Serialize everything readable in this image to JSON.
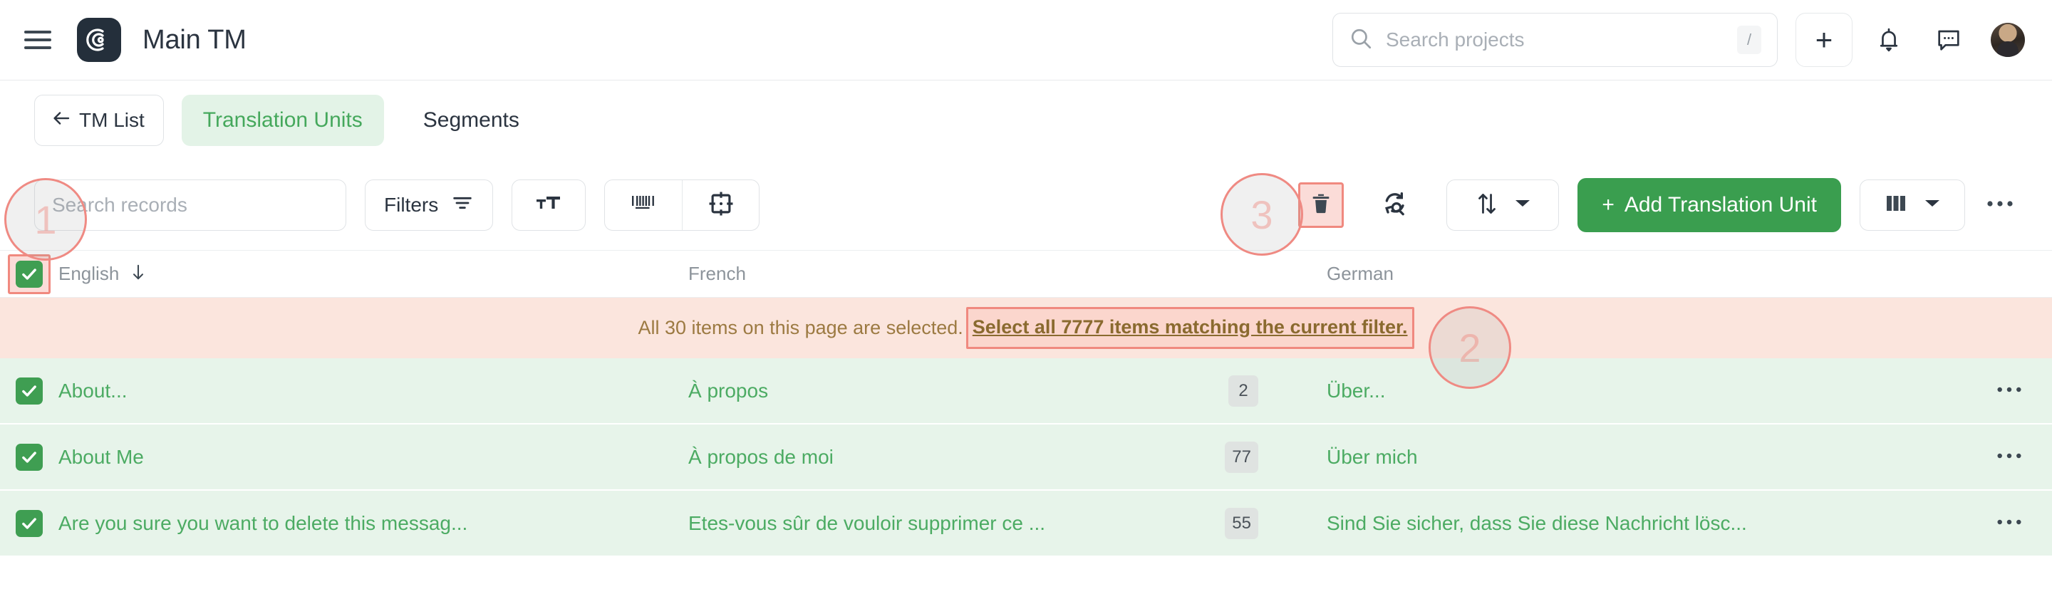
{
  "header": {
    "menu_icon": "hamburger-icon",
    "logo_icon": "app-logo-icon",
    "title": "Main TM",
    "search": {
      "placeholder": "Search projects",
      "shortcut": "/",
      "icon": "search-icon"
    },
    "add_button_label": "+",
    "notifications_icon": "bell-icon",
    "messages_icon": "chat-icon",
    "avatar": "user-avatar"
  },
  "tabs": {
    "back_label": "TM List",
    "back_icon": "arrow-left-icon",
    "items": [
      {
        "label": "Translation Units",
        "active": true
      },
      {
        "label": "Segments",
        "active": false
      }
    ]
  },
  "toolbar": {
    "search_placeholder": "Search records",
    "filters_label": "Filters",
    "filters_icon": "filter-icon",
    "font_size_icon": "text-size-icon",
    "barcode_icon": "barcode-icon",
    "tag_icon": "placeholder-target-icon",
    "delete_icon": "trash-icon",
    "refresh_icon": "refresh-search-icon",
    "sort_icon": "sort-arrows-icon",
    "sort_caret": "chevron-down-icon",
    "add_label": "Add Translation Unit",
    "add_prefix": "+",
    "columns_icon": "columns-icon",
    "columns_caret": "chevron-down-icon",
    "more_icon": "more-horizontal-icon"
  },
  "table": {
    "header_checkbox_checked": true,
    "columns": [
      {
        "label": "English",
        "sort_icon": "arrow-down-icon"
      },
      {
        "label": "French"
      },
      {
        "label": "German"
      }
    ],
    "banner": {
      "text": "All 30 items on this page are selected.",
      "link": "Select all 7777 items matching the current filter.",
      "count_page": "30",
      "count_total": "7777"
    },
    "rows": [
      {
        "checked": true,
        "english": "About...",
        "french": "À propos",
        "count": "2",
        "german": "Über...",
        "actions_icon": "more-horizontal-icon"
      },
      {
        "checked": true,
        "english": "About Me",
        "french": "À propos de moi",
        "count": "77",
        "german": "Über mich",
        "actions_icon": "more-horizontal-icon"
      },
      {
        "checked": true,
        "english": "Are you sure you want to delete this messag...",
        "french": "Etes-vous sûr de vouloir supprimer ce ...",
        "count": "55",
        "german": "Sind Sie sicher, dass Sie diese Nachricht lösc...",
        "actions_icon": "more-horizontal-icon"
      }
    ]
  },
  "annotations": [
    {
      "id": "1",
      "label": "1"
    },
    {
      "id": "2",
      "label": "2"
    },
    {
      "id": "3",
      "label": "3"
    }
  ],
  "colors": {
    "accent_green": "#3a9e4f",
    "tab_green_text": "#45a85c",
    "tab_green_bg": "#e3f3e7",
    "row_green_bg": "#e7f4ea",
    "banner_bg": "#fbe5dd",
    "banner_text": "#9c7a42",
    "highlight_border": "#f0897f",
    "dark": "#2b3440"
  }
}
